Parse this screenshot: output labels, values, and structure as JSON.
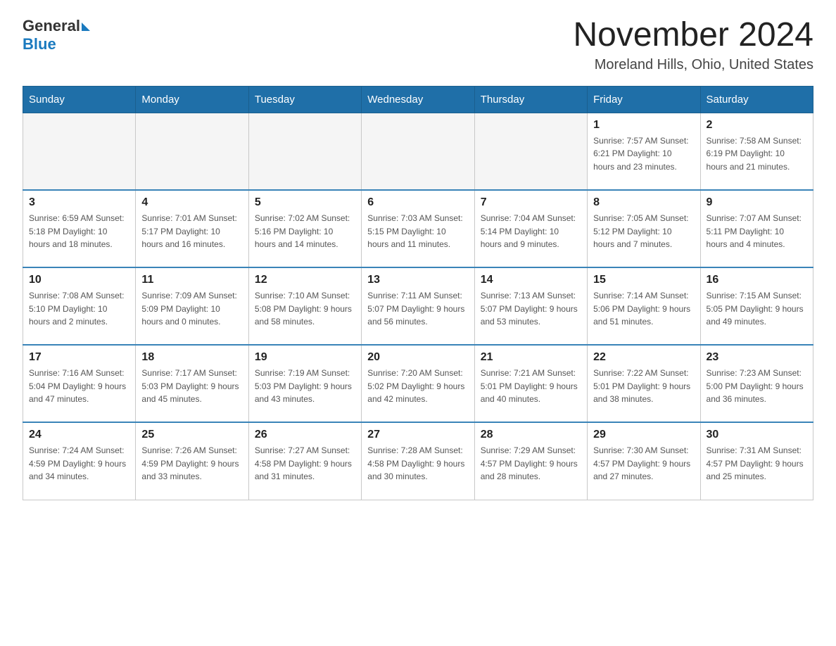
{
  "header": {
    "logo_general": "General",
    "logo_blue": "Blue",
    "month_title": "November 2024",
    "location": "Moreland Hills, Ohio, United States"
  },
  "days_of_week": [
    "Sunday",
    "Monday",
    "Tuesday",
    "Wednesday",
    "Thursday",
    "Friday",
    "Saturday"
  ],
  "weeks": [
    [
      {
        "day": "",
        "info": ""
      },
      {
        "day": "",
        "info": ""
      },
      {
        "day": "",
        "info": ""
      },
      {
        "day": "",
        "info": ""
      },
      {
        "day": "",
        "info": ""
      },
      {
        "day": "1",
        "info": "Sunrise: 7:57 AM\nSunset: 6:21 PM\nDaylight: 10 hours and 23 minutes."
      },
      {
        "day": "2",
        "info": "Sunrise: 7:58 AM\nSunset: 6:19 PM\nDaylight: 10 hours and 21 minutes."
      }
    ],
    [
      {
        "day": "3",
        "info": "Sunrise: 6:59 AM\nSunset: 5:18 PM\nDaylight: 10 hours and 18 minutes."
      },
      {
        "day": "4",
        "info": "Sunrise: 7:01 AM\nSunset: 5:17 PM\nDaylight: 10 hours and 16 minutes."
      },
      {
        "day": "5",
        "info": "Sunrise: 7:02 AM\nSunset: 5:16 PM\nDaylight: 10 hours and 14 minutes."
      },
      {
        "day": "6",
        "info": "Sunrise: 7:03 AM\nSunset: 5:15 PM\nDaylight: 10 hours and 11 minutes."
      },
      {
        "day": "7",
        "info": "Sunrise: 7:04 AM\nSunset: 5:14 PM\nDaylight: 10 hours and 9 minutes."
      },
      {
        "day": "8",
        "info": "Sunrise: 7:05 AM\nSunset: 5:12 PM\nDaylight: 10 hours and 7 minutes."
      },
      {
        "day": "9",
        "info": "Sunrise: 7:07 AM\nSunset: 5:11 PM\nDaylight: 10 hours and 4 minutes."
      }
    ],
    [
      {
        "day": "10",
        "info": "Sunrise: 7:08 AM\nSunset: 5:10 PM\nDaylight: 10 hours and 2 minutes."
      },
      {
        "day": "11",
        "info": "Sunrise: 7:09 AM\nSunset: 5:09 PM\nDaylight: 10 hours and 0 minutes."
      },
      {
        "day": "12",
        "info": "Sunrise: 7:10 AM\nSunset: 5:08 PM\nDaylight: 9 hours and 58 minutes."
      },
      {
        "day": "13",
        "info": "Sunrise: 7:11 AM\nSunset: 5:07 PM\nDaylight: 9 hours and 56 minutes."
      },
      {
        "day": "14",
        "info": "Sunrise: 7:13 AM\nSunset: 5:07 PM\nDaylight: 9 hours and 53 minutes."
      },
      {
        "day": "15",
        "info": "Sunrise: 7:14 AM\nSunset: 5:06 PM\nDaylight: 9 hours and 51 minutes."
      },
      {
        "day": "16",
        "info": "Sunrise: 7:15 AM\nSunset: 5:05 PM\nDaylight: 9 hours and 49 minutes."
      }
    ],
    [
      {
        "day": "17",
        "info": "Sunrise: 7:16 AM\nSunset: 5:04 PM\nDaylight: 9 hours and 47 minutes."
      },
      {
        "day": "18",
        "info": "Sunrise: 7:17 AM\nSunset: 5:03 PM\nDaylight: 9 hours and 45 minutes."
      },
      {
        "day": "19",
        "info": "Sunrise: 7:19 AM\nSunset: 5:03 PM\nDaylight: 9 hours and 43 minutes."
      },
      {
        "day": "20",
        "info": "Sunrise: 7:20 AM\nSunset: 5:02 PM\nDaylight: 9 hours and 42 minutes."
      },
      {
        "day": "21",
        "info": "Sunrise: 7:21 AM\nSunset: 5:01 PM\nDaylight: 9 hours and 40 minutes."
      },
      {
        "day": "22",
        "info": "Sunrise: 7:22 AM\nSunset: 5:01 PM\nDaylight: 9 hours and 38 minutes."
      },
      {
        "day": "23",
        "info": "Sunrise: 7:23 AM\nSunset: 5:00 PM\nDaylight: 9 hours and 36 minutes."
      }
    ],
    [
      {
        "day": "24",
        "info": "Sunrise: 7:24 AM\nSunset: 4:59 PM\nDaylight: 9 hours and 34 minutes."
      },
      {
        "day": "25",
        "info": "Sunrise: 7:26 AM\nSunset: 4:59 PM\nDaylight: 9 hours and 33 minutes."
      },
      {
        "day": "26",
        "info": "Sunrise: 7:27 AM\nSunset: 4:58 PM\nDaylight: 9 hours and 31 minutes."
      },
      {
        "day": "27",
        "info": "Sunrise: 7:28 AM\nSunset: 4:58 PM\nDaylight: 9 hours and 30 minutes."
      },
      {
        "day": "28",
        "info": "Sunrise: 7:29 AM\nSunset: 4:57 PM\nDaylight: 9 hours and 28 minutes."
      },
      {
        "day": "29",
        "info": "Sunrise: 7:30 AM\nSunset: 4:57 PM\nDaylight: 9 hours and 27 minutes."
      },
      {
        "day": "30",
        "info": "Sunrise: 7:31 AM\nSunset: 4:57 PM\nDaylight: 9 hours and 25 minutes."
      }
    ]
  ]
}
